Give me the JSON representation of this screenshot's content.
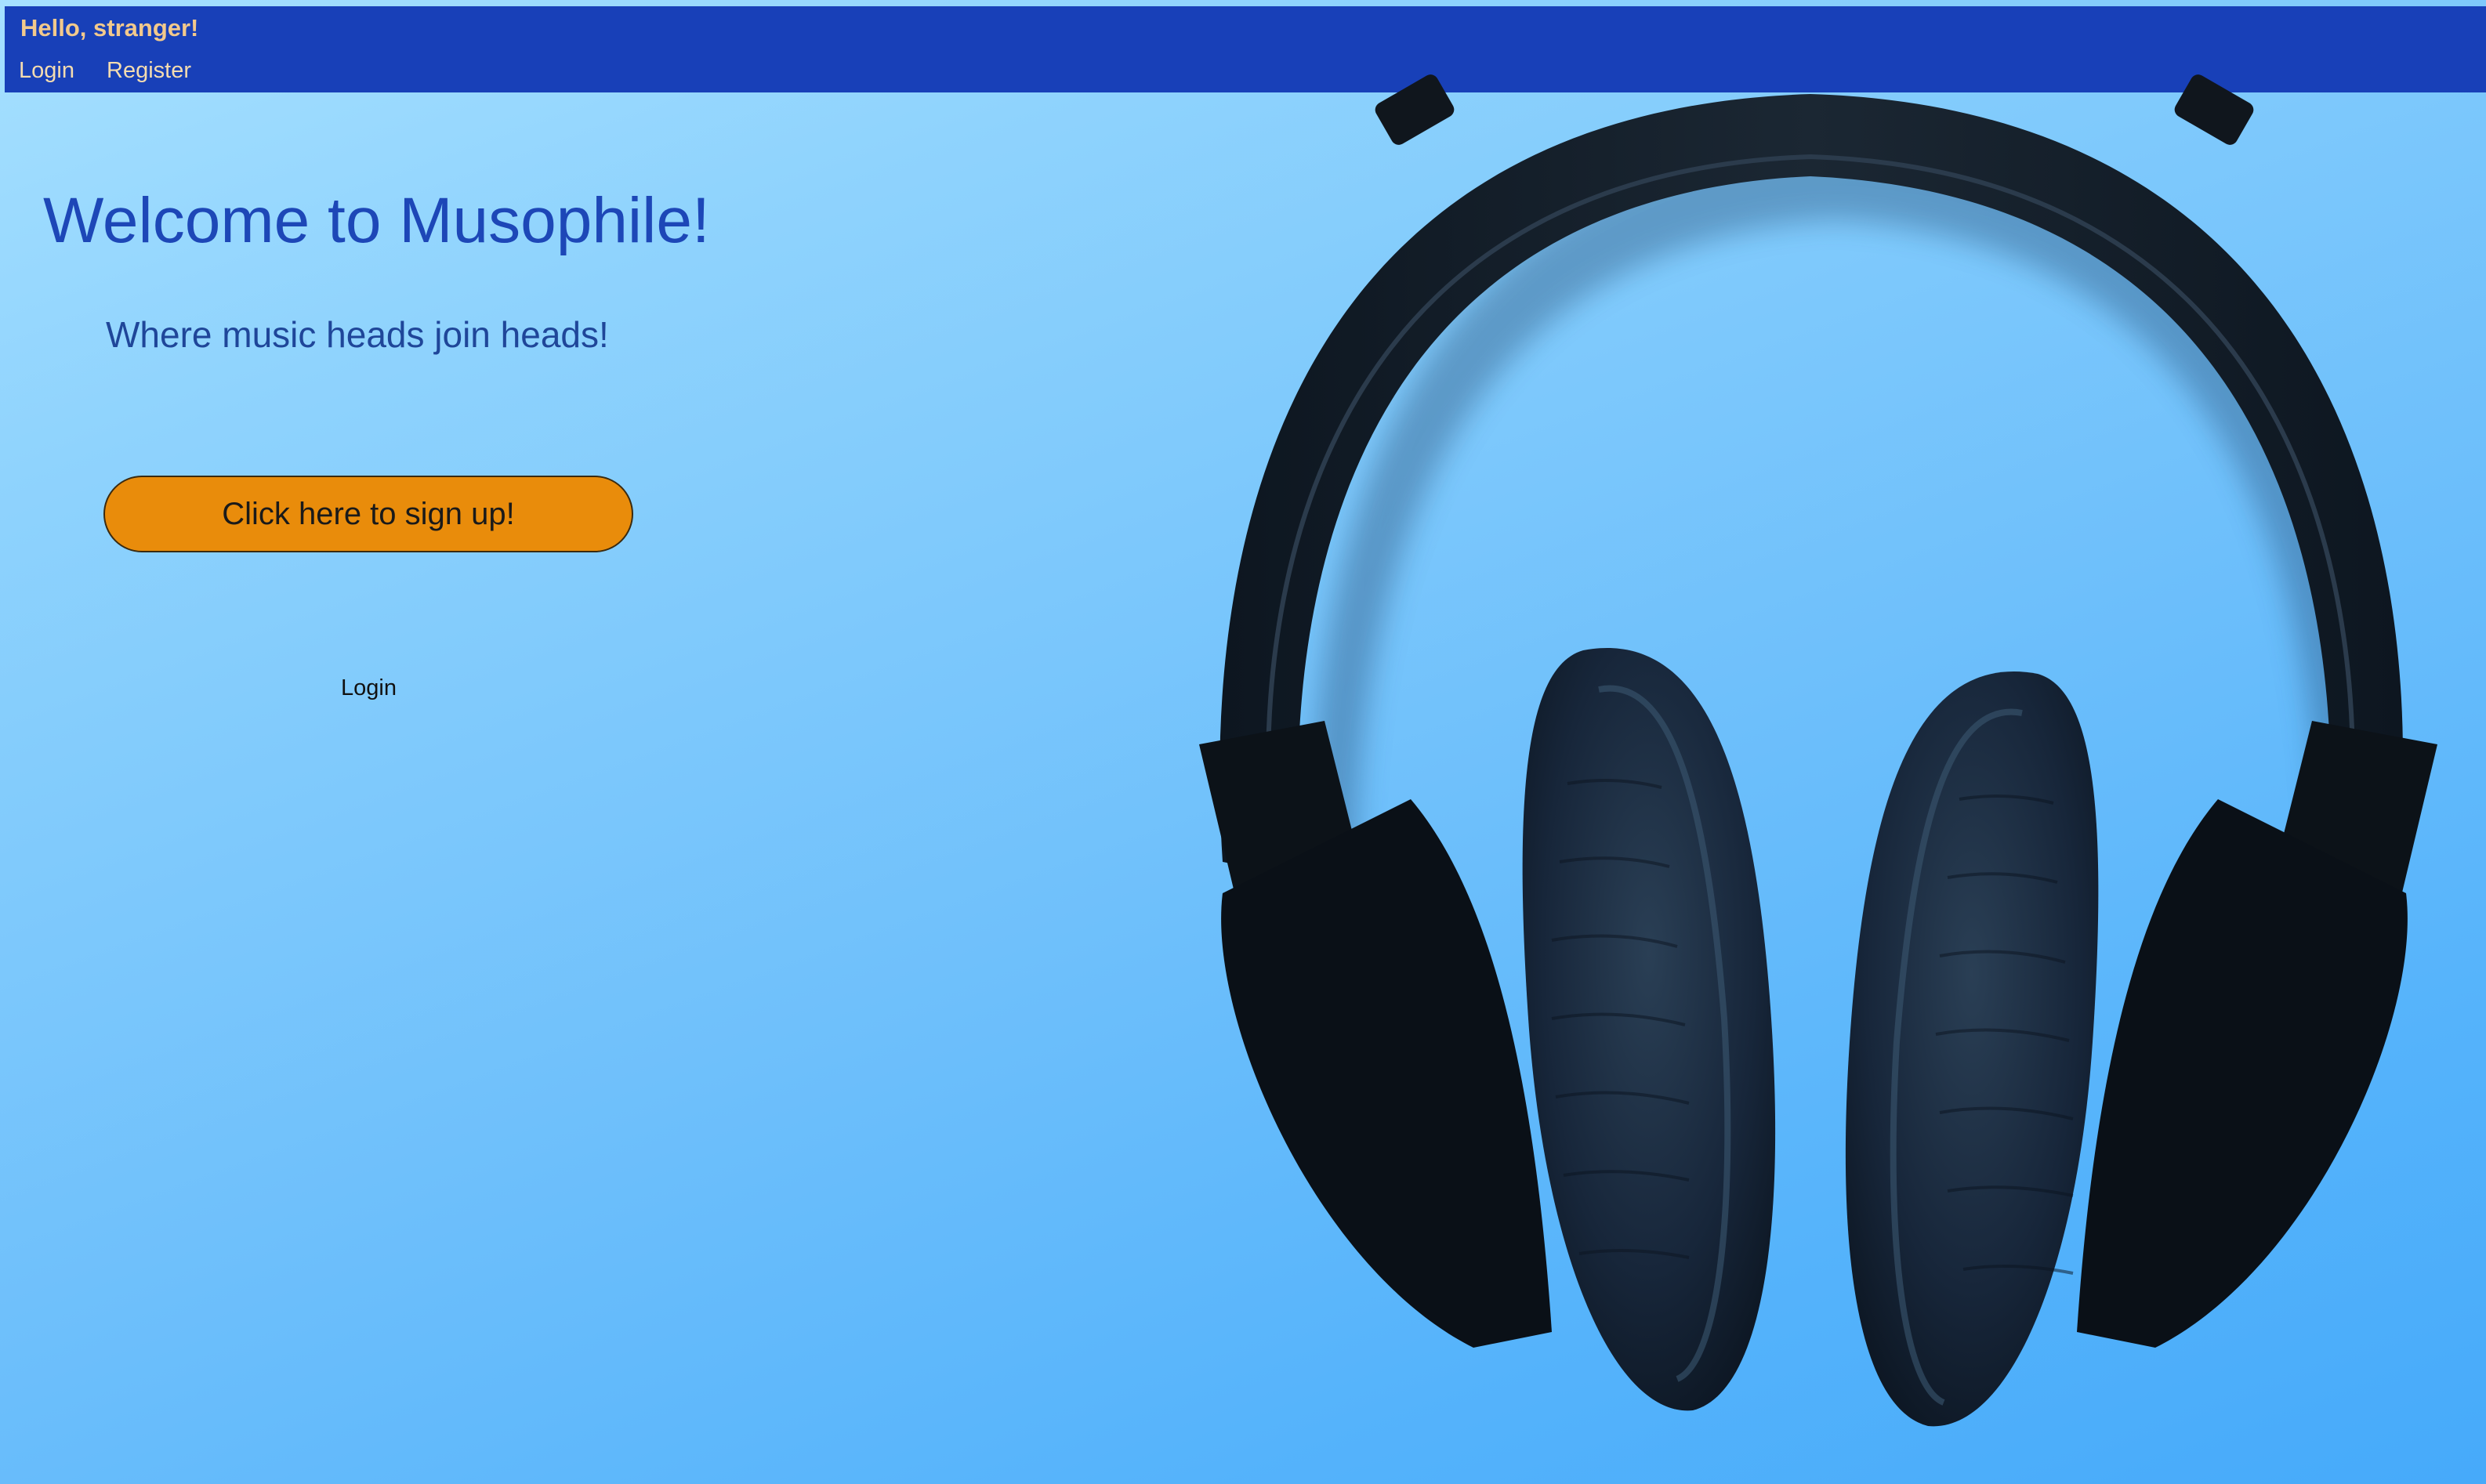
{
  "header": {
    "greeting": "Hello, stranger!",
    "nav": {
      "login": "Login",
      "register": "Register"
    }
  },
  "hero": {
    "title": "Welcome to Musophile!",
    "tagline": "Where music heads join heads!",
    "signup_label": "Click here to sign up!",
    "login_label": "Login"
  },
  "colors": {
    "header_bg": "#1840b8",
    "header_text": "#f2c98c",
    "title": "#1d47b7",
    "button": "#e98c0b"
  },
  "image": {
    "subject": "headphones"
  }
}
